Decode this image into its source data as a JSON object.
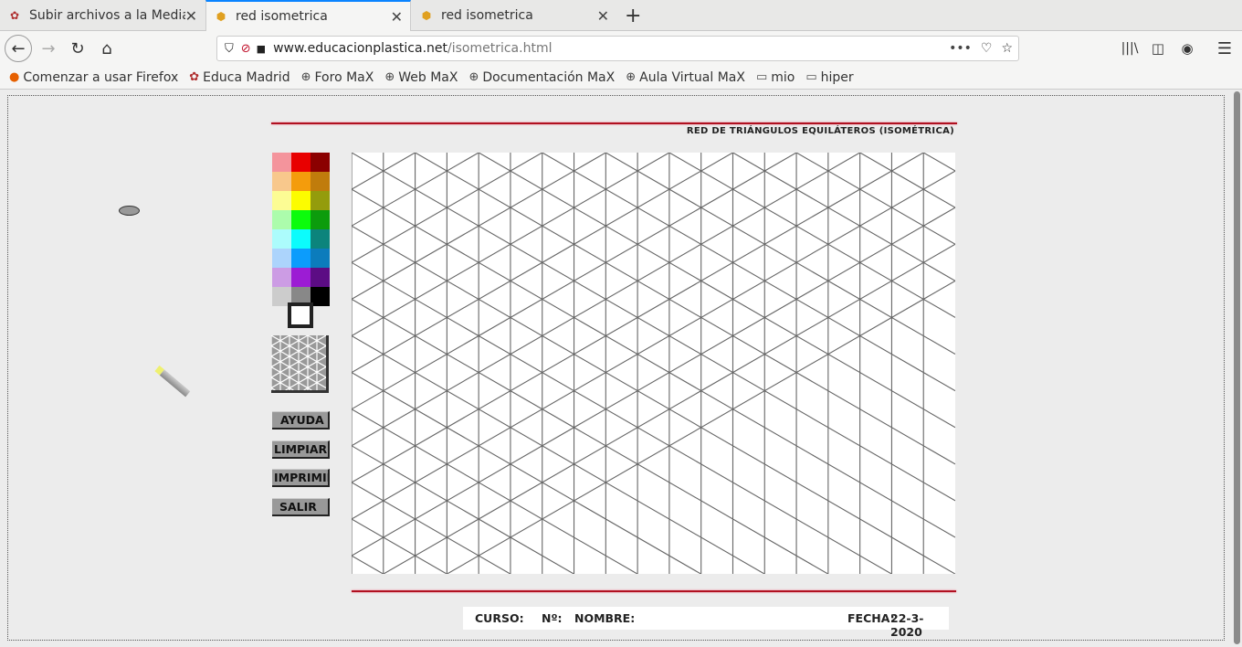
{
  "browser": {
    "tabs": [
      {
        "label": "Subir archivos a la Media",
        "icon": "educamadrid-icon",
        "active": false
      },
      {
        "label": "red isometrica",
        "icon": "site-icon",
        "active": true
      },
      {
        "label": "red isometrica",
        "icon": "site-icon",
        "active": false
      }
    ],
    "url_domain": "www.educacionplastica.net",
    "url_path": "/isometrica.html",
    "bookmarks": [
      {
        "label": "Comenzar a usar Firefox",
        "icon": "firefox-icon"
      },
      {
        "label": "Educa Madrid",
        "icon": "educamadrid-icon"
      },
      {
        "label": "Foro MaX",
        "icon": "globe-icon"
      },
      {
        "label": "Web MaX",
        "icon": "globe-icon"
      },
      {
        "label": "Documentación MaX",
        "icon": "globe-icon"
      },
      {
        "label": "Aula Virtual MaX",
        "icon": "globe-icon"
      },
      {
        "label": "mio",
        "icon": "folder-icon"
      },
      {
        "label": "hiper",
        "icon": "folder-icon"
      }
    ]
  },
  "page": {
    "title": "RED DE TRIÁNGULOS EQUILÁTEROS (ISOMÉTRICA)",
    "palette": [
      [
        "#f4949c",
        "#e80000",
        "#8b0000"
      ],
      [
        "#f8c88c",
        "#f49c0c",
        "#c07c0c"
      ],
      [
        "#fcfc94",
        "#fcfc00",
        "#949c0c"
      ],
      [
        "#acfcac",
        "#0cfc0c",
        "#0c9c0c"
      ],
      [
        "#acfcfc",
        "#0cfcfc",
        "#0c847c"
      ],
      [
        "#acd4fc",
        "#0c9cfc",
        "#0c7cbc"
      ],
      [
        "#cc9ce4",
        "#9c1cd4",
        "#5c0c84"
      ],
      [
        "#cccccc",
        "#888888",
        "#000000"
      ]
    ],
    "selected_color": "#ffffff",
    "accent": "#b01020",
    "buttons": {
      "help": "AYUDA",
      "clear": "LIMPIAR",
      "print": "IMPRIMIR",
      "exit": "SALIR"
    },
    "footer": {
      "course": "CURSO:",
      "number": "Nº:",
      "name": "NOMBRE:",
      "date_label": "FECHA:",
      "date": "22-3-2020"
    }
  }
}
